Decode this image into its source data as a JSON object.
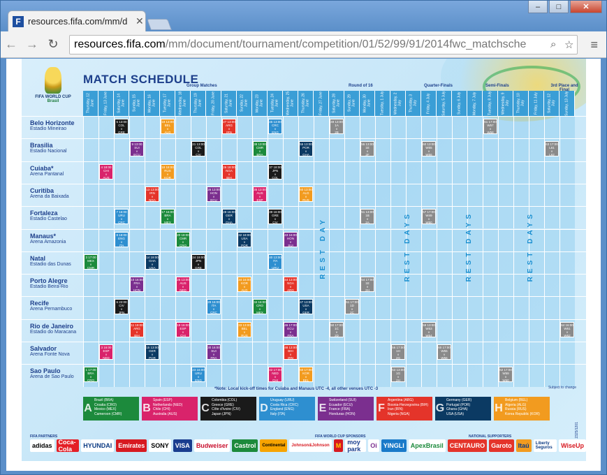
{
  "browser": {
    "tab_title": "resources.fifa.com/mm/d",
    "url_host": "resources.fifa.com",
    "url_path": "/mm/document/tournament/competition/01/52/99/91/2014fwc_matchsche",
    "favicon_letter": "F",
    "minimize": "–",
    "maximize": "□",
    "close": "✕"
  },
  "poster": {
    "title": "MATCH SCHEDULE",
    "logo_line1": "FIFA WORLD CUP",
    "logo_line2": "Brasil",
    "phases": {
      "group": "Group Matches",
      "r16": "Round of 16",
      "qf": "Quarter-Finals",
      "sf": "Semi-Finals",
      "third": "3rd Place and Final"
    },
    "days": [
      "Thursday, 12 June",
      "Friday, 13 June",
      "Saturday, 14 June",
      "Sunday, 15 June",
      "Monday, 16 June",
      "Tuesday, 17 June",
      "Wednesday, 18 June",
      "Thursday, 19 June",
      "Friday, 20 June",
      "Saturday, 21 June",
      "Sunday, 22 June",
      "Monday, 23 June",
      "Tuesday, 24 June",
      "Wednesday, 25 June",
      "Thursday, 26 June",
      "Friday, 27 June",
      "Saturday, 28 June",
      "Sunday, 29 June",
      "Monday, 30 June",
      "Tuesday, 1 July",
      "Wednesday, 2 July",
      "Thursday, 3 July",
      "Friday, 4 July",
      "Saturday, 5 July",
      "Sunday, 6 July",
      "Monday, 7 July",
      "Tuesday, 8 July",
      "Wednesday, 9 July",
      "Thursday, 10 July",
      "Friday, 11 July",
      "Saturday, 12 July",
      "Sunday, 13 July"
    ],
    "venues": [
      {
        "city": "Belo Horizonte",
        "stadium": "Estadio Mineirao"
      },
      {
        "city": "Brasilia",
        "stadium": "Estadio Nacional"
      },
      {
        "city": "Cuiaba*",
        "stadium": "Arena Pantanal"
      },
      {
        "city": "Curitiba",
        "stadium": "Arena da Baixada"
      },
      {
        "city": "Fortaleza",
        "stadium": "Estadio Castelao"
      },
      {
        "city": "Manaus*",
        "stadium": "Arena Amazonia"
      },
      {
        "city": "Natal",
        "stadium": "Estadio das Dunas"
      },
      {
        "city": "Porto Alegre",
        "stadium": "Estadio Beira-Rio"
      },
      {
        "city": "Recife",
        "stadium": "Arena Pernambuco"
      },
      {
        "city": "Rio de Janeiro",
        "stadium": "Estadio do Maracana"
      },
      {
        "city": "Salvador",
        "stadium": "Arena Fonte Nova"
      },
      {
        "city": "Sao Paulo",
        "stadium": "Arena de Sao Paulo"
      }
    ],
    "matches": [
      {
        "row": 0,
        "col": 2,
        "num": "5",
        "time": "13:00",
        "t1": "COL",
        "t2": "GRE",
        "color": "#1a1a1a"
      },
      {
        "row": 0,
        "col": 5,
        "num": "19",
        "time": "13:00",
        "t1": "BEL",
        "t2": "ALG",
        "color": "#f29b1f"
      },
      {
        "row": 0,
        "col": 9,
        "num": "27",
        "time": "13:00",
        "t1": "ARG",
        "t2": "IRN",
        "color": "#e4342a"
      },
      {
        "row": 0,
        "col": 12,
        "num": "45",
        "time": "13:00",
        "t1": "CRC",
        "t2": "ENG",
        "color": "#2e8fd0"
      },
      {
        "row": 0,
        "col": 16,
        "num": "49",
        "time": "13:00",
        "t1": "1A",
        "t2": "2B",
        "color": "#8a8a8a"
      },
      {
        "row": 1,
        "col": 3,
        "num": "9",
        "time": "13:00",
        "t1": "SUI",
        "t2": "ECU",
        "color": "#7b2f8f"
      },
      {
        "row": 1,
        "col": 7,
        "num": "21",
        "time": "13:00",
        "t1": "COL",
        "t2": "CIV",
        "color": "#1a1a1a"
      },
      {
        "row": 1,
        "col": 11,
        "num": "38",
        "time": "13:00",
        "t1": "CMR",
        "t2": "BRA",
        "color": "#1c8a3c"
      },
      {
        "row": 1,
        "col": 14,
        "num": "55",
        "time": "13:00",
        "t1": "POR",
        "t2": "GHA",
        "color": "#0b3a63"
      },
      {
        "row": 1,
        "col": 18,
        "num": "55",
        "time": "13:00",
        "t1": "1E",
        "t2": "2F",
        "color": "#8a8a8a"
      },
      {
        "row": 2,
        "col": 1,
        "num": "4",
        "time": "18:00",
        "t1": "CHI",
        "t2": "AUS",
        "color": "#d9236b"
      },
      {
        "row": 2,
        "col": 5,
        "num": "18",
        "time": "18:00",
        "t1": "RUS",
        "t2": "KOR",
        "color": "#f29b1f"
      },
      {
        "row": 2,
        "col": 9,
        "num": "26",
        "time": "18:00",
        "t1": "NGA",
        "t2": "BIH",
        "color": "#e4342a"
      },
      {
        "row": 2,
        "col": 12,
        "num": "37",
        "time": "18:00",
        "t1": "JPN",
        "t2": "COL",
        "color": "#1a1a1a"
      },
      {
        "row": 3,
        "col": 4,
        "num": "13",
        "time": "13:00",
        "t1": "IRN",
        "t2": "NGA",
        "color": "#e4342a"
      },
      {
        "row": 3,
        "col": 8,
        "num": "26",
        "time": "13:00",
        "t1": "HON",
        "t2": "ECU",
        "color": "#7b2f8f"
      },
      {
        "row": 3,
        "col": 11,
        "num": "35",
        "time": "13:00",
        "t1": "AUS",
        "t2": "ESP",
        "color": "#d9236b"
      },
      {
        "row": 3,
        "col": 14,
        "num": "60",
        "time": "13:00",
        "t1": "ALG",
        "t2": "RUS",
        "color": "#f29b1f"
      },
      {
        "row": 4,
        "col": 2,
        "num": "7",
        "time": "16:00",
        "t1": "URU",
        "t2": "CRC",
        "color": "#2e8fd0"
      },
      {
        "row": 4,
        "col": 5,
        "num": "17",
        "time": "16:00",
        "t1": "BRA",
        "t2": "MEX",
        "color": "#1c8a3c"
      },
      {
        "row": 4,
        "col": 9,
        "num": "28",
        "time": "16:00",
        "t1": "GER",
        "t2": "GHA",
        "color": "#0b3a63"
      },
      {
        "row": 4,
        "col": 12,
        "num": "39",
        "time": "16:00",
        "t1": "GRE",
        "t2": "CIV",
        "color": "#1a1a1a"
      },
      {
        "row": 4,
        "col": 18,
        "num": "51",
        "time": "13:00",
        "t1": "1B",
        "t2": "2A",
        "color": "#8a8a8a"
      },
      {
        "row": 4,
        "col": 22,
        "num": "57",
        "time": "17:00",
        "t1": "W49",
        "t2": "W50",
        "color": "#8a8a8a"
      },
      {
        "row": 5,
        "col": 2,
        "num": "8",
        "time": "18:00",
        "t1": "ENG",
        "t2": "ITA",
        "color": "#2e8fd0"
      },
      {
        "row": 5,
        "col": 6,
        "num": "20",
        "time": "18:00",
        "t1": "CMR",
        "t2": "CRO",
        "color": "#1c8a3c"
      },
      {
        "row": 5,
        "col": 10,
        "num": "32",
        "time": "18:00",
        "t1": "USA",
        "t2": "POR",
        "color": "#0b3a63"
      },
      {
        "row": 5,
        "col": 13,
        "num": "43",
        "time": "16:00",
        "t1": "HON",
        "t2": "SUI",
        "color": "#7b2f8f"
      },
      {
        "row": 6,
        "col": 0,
        "num": "3",
        "time": "17:00",
        "t1": "MEX",
        "t2": "CMR",
        "color": "#1c8a3c"
      },
      {
        "row": 6,
        "col": 4,
        "num": "14",
        "time": "19:00",
        "t1": "GHA",
        "t2": "USA",
        "color": "#0b3a63"
      },
      {
        "row": 6,
        "col": 7,
        "num": "24",
        "time": "19:00",
        "t1": "JPN",
        "t2": "GRE",
        "color": "#1a1a1a"
      },
      {
        "row": 6,
        "col": 12,
        "num": "40",
        "time": "13:00",
        "t1": "ITA",
        "t2": "URU",
        "color": "#2e8fd0"
      },
      {
        "row": 7,
        "col": 3,
        "num": "10",
        "time": "16:00",
        "t1": "FRA",
        "t2": "HON",
        "color": "#7b2f8f"
      },
      {
        "row": 7,
        "col": 6,
        "num": "25",
        "time": "13:00",
        "t1": "AUS",
        "t2": "NED",
        "color": "#d9236b"
      },
      {
        "row": 7,
        "col": 10,
        "num": "34",
        "time": "16:00",
        "t1": "KOR",
        "t2": "ALG",
        "color": "#f29b1f"
      },
      {
        "row": 7,
        "col": 13,
        "num": "44",
        "time": "13:00",
        "t1": "NGA",
        "t2": "ARG",
        "color": "#e4342a"
      },
      {
        "row": 7,
        "col": 18,
        "num": "54",
        "time": "17:00",
        "t1": "1E",
        "t2": "2H",
        "color": "#8a8a8a"
      },
      {
        "row": 8,
        "col": 2,
        "num": "6",
        "time": "22:00",
        "t1": "CIV",
        "t2": "JPN",
        "color": "#1a1a1a"
      },
      {
        "row": 8,
        "col": 8,
        "num": "29",
        "time": "16:00",
        "t1": "ITA",
        "t2": "CRC",
        "color": "#2e8fd0"
      },
      {
        "row": 8,
        "col": 11,
        "num": "34",
        "time": "16:00",
        "t1": "CRO",
        "t2": "MEX",
        "color": "#1c8a3c"
      },
      {
        "row": 8,
        "col": 14,
        "num": "47",
        "time": "13:00",
        "t1": "USA",
        "t2": "GER",
        "color": "#0b3a63"
      },
      {
        "row": 8,
        "col": 17,
        "num": "51",
        "time": "17:00",
        "t1": "1D",
        "t2": "2C",
        "color": "#8a8a8a"
      },
      {
        "row": 9,
        "col": 3,
        "num": "11",
        "time": "19:00",
        "t1": "ARG",
        "t2": "BIH",
        "color": "#e4342a"
      },
      {
        "row": 9,
        "col": 6,
        "num": "19",
        "time": "16:00",
        "t1": "ESP",
        "t2": "CHI",
        "color": "#d9236b"
      },
      {
        "row": 9,
        "col": 10,
        "num": "33",
        "time": "13:00",
        "t1": "BEL",
        "t2": "RUS",
        "color": "#f29b1f"
      },
      {
        "row": 9,
        "col": 13,
        "num": "46",
        "time": "17:00",
        "t1": "ECU",
        "t2": "FRA",
        "color": "#7b2f8f"
      },
      {
        "row": 9,
        "col": 16,
        "num": "50",
        "time": "17:00",
        "t1": "1C",
        "t2": "2D",
        "color": "#8a8a8a"
      },
      {
        "row": 9,
        "col": 22,
        "num": "59",
        "time": "13:00",
        "t1": "W53",
        "t2": "W54",
        "color": "#8a8a8a"
      },
      {
        "row": 9,
        "col": 31,
        "num": "64",
        "time": "16:00",
        "t1": "W61",
        "t2": "W62",
        "color": "#8a8a8a"
      },
      {
        "row": 10,
        "col": 1,
        "num": "3",
        "time": "16:00",
        "t1": "ESP",
        "t2": "NED",
        "color": "#d9236b"
      },
      {
        "row": 10,
        "col": 4,
        "num": "15",
        "time": "13:00",
        "t1": "GER",
        "t2": "POR",
        "color": "#0b3a63"
      },
      {
        "row": 10,
        "col": 8,
        "num": "30",
        "time": "16:00",
        "t1": "SUI",
        "t2": "FRA",
        "color": "#7b2f8f"
      },
      {
        "row": 10,
        "col": 13,
        "num": "48",
        "time": "13:00",
        "t1": "BIH",
        "t2": "IRN",
        "color": "#e4342a"
      },
      {
        "row": 10,
        "col": 20,
        "num": "56",
        "time": "17:00",
        "t1": "1H",
        "t2": "2G",
        "color": "#8a8a8a"
      },
      {
        "row": 10,
        "col": 23,
        "num": "60",
        "time": "17:00",
        "t1": "W55",
        "t2": "W56",
        "color": "#8a8a8a"
      },
      {
        "row": 11,
        "col": 0,
        "num": "1",
        "time": "17:00",
        "t1": "BRA",
        "t2": "CRO",
        "color": "#1c8a3c"
      },
      {
        "row": 11,
        "col": 7,
        "num": "23",
        "time": "16:00",
        "t1": "URU",
        "t2": "ENG",
        "color": "#2e8fd0"
      },
      {
        "row": 11,
        "col": 12,
        "num": "42",
        "time": "17:00",
        "t1": "NED",
        "t2": "CHI",
        "color": "#d9236b"
      },
      {
        "row": 11,
        "col": 14,
        "num": "50",
        "time": "17:00",
        "t1": "KOR",
        "t2": "BEL",
        "color": "#f29b1f"
      },
      {
        "row": 11,
        "col": 20,
        "num": "53",
        "time": "13:00",
        "t1": "1G",
        "t2": "2H",
        "color": "#8a8a8a"
      },
      {
        "row": 11,
        "col": 27,
        "num": "62",
        "time": "17:00",
        "t1": "W59",
        "t2": "W60",
        "color": "#8a8a8a"
      },
      {
        "row": 0,
        "col": 26,
        "num": "61",
        "time": "17:00",
        "t1": "W57",
        "t2": "W58",
        "color": "#8a8a8a"
      },
      {
        "row": 1,
        "col": 30,
        "num": "63",
        "time": "17:00",
        "t1": "L61",
        "t2": "L62",
        "color": "#8a8a8a"
      },
      {
        "row": 1,
        "col": 22,
        "num": "60",
        "time": "13:00",
        "t1": "W55",
        "t2": "W56",
        "color": "#8a8a8a"
      }
    ],
    "rest_label": "REST DAY",
    "rest_days_label": "REST DAYS",
    "note": "*Note: Local kick-off times for Cuiaba and Manaus UTC -4, all other venues UTC -3",
    "subject_to_change": "Subject to change",
    "groups": [
      {
        "letter": "A",
        "color": "#1c8a3c",
        "teams": [
          "Brazil (BRA)",
          "Croatia (CRO)",
          "Mexico (MEX)",
          "Cameroon (CMR)"
        ]
      },
      {
        "letter": "B",
        "color": "#d9236b",
        "teams": [
          "Spain (ESP)",
          "Netherlands (NED)",
          "Chile (CHI)",
          "Australia (AUS)"
        ]
      },
      {
        "letter": "C",
        "color": "#1a1a1a",
        "teams": [
          "Colombia (COL)",
          "Greece (GRE)",
          "Côte d'Ivoire (CIV)",
          "Japan (JPN)"
        ]
      },
      {
        "letter": "D",
        "color": "#2e8fd0",
        "teams": [
          "Uruguay (URU)",
          "Costa Rica (CRC)",
          "England (ENG)",
          "Italy (ITA)"
        ]
      },
      {
        "letter": "E",
        "color": "#7b2f8f",
        "teams": [
          "Switzerland (SUI)",
          "Ecuador (ECU)",
          "France (FRA)",
          "Honduras (HON)"
        ]
      },
      {
        "letter": "F",
        "color": "#e4342a",
        "teams": [
          "Argentina (ARG)",
          "Bosnia-Herzegovina (BIH)",
          "Iran (IRN)",
          "Nigeria (NGA)"
        ]
      },
      {
        "letter": "G",
        "color": "#0b3a63",
        "teams": [
          "Germany (GER)",
          "Portugal (POR)",
          "Ghana (GHA)",
          "USA (USA)"
        ]
      },
      {
        "letter": "H",
        "color": "#f29b1f",
        "teams": [
          "Belgium (BEL)",
          "Algeria (ALG)",
          "Russia (RUS)",
          "Korea Republic (KOR)"
        ]
      }
    ],
    "partners_label": "FIFA PARTNERS",
    "sponsors_label": "FIFA WORLD CUP SPONSORS",
    "national_label": "NATIONAL SUPPORTERS",
    "sponsors": [
      {
        "name": "adidas",
        "bg": "#ffffff",
        "fg": "#000000"
      },
      {
        "name": "Coca-Cola",
        "bg": "#e41e26",
        "fg": "#ffffff"
      },
      {
        "name": "HYUNDAI",
        "bg": "#ffffff",
        "fg": "#0b3a83"
      },
      {
        "name": "Emirates",
        "bg": "#d71920",
        "fg": "#ffffff"
      },
      {
        "name": "SONY",
        "bg": "#ffffff",
        "fg": "#000000"
      },
      {
        "name": "VISA",
        "bg": "#1a3d8f",
        "fg": "#ffffff"
      },
      {
        "name": "Budweiser",
        "bg": "#ffffff",
        "fg": "#c8102e"
      },
      {
        "name": "Castrol",
        "bg": "#1c8a3c",
        "fg": "#ffffff"
      },
      {
        "name": "Continental",
        "bg": "#f7a400",
        "fg": "#000000"
      },
      {
        "name": "Johnson&Johnson",
        "bg": "#ffffff",
        "fg": "#d71920"
      },
      {
        "name": "M",
        "bg": "#d71920",
        "fg": "#ffcc00"
      },
      {
        "name": "moy park",
        "bg": "#ffffff",
        "fg": "#1a3d8f"
      },
      {
        "name": "Oi",
        "bg": "#ffffff",
        "fg": "#7b2f8f"
      },
      {
        "name": "YINGLI",
        "bg": "#1a7ac9",
        "fg": "#ffffff"
      },
      {
        "name": "ApexBrasil",
        "bg": "#ffffff",
        "fg": "#1c8a3c"
      },
      {
        "name": "CENTAURO",
        "bg": "#e4342a",
        "fg": "#ffffff"
      },
      {
        "name": "Garoto",
        "bg": "#e4342a",
        "fg": "#ffffff"
      },
      {
        "name": "Itaú",
        "bg": "#f29b1f",
        "fg": "#0b3a83"
      },
      {
        "name": "Liberty Seguros",
        "bg": "#ffffff",
        "fg": "#0b3a83"
      },
      {
        "name": "WiseUp",
        "bg": "#ffffff",
        "fg": "#d71920"
      }
    ],
    "side_code": "2325/1201"
  }
}
